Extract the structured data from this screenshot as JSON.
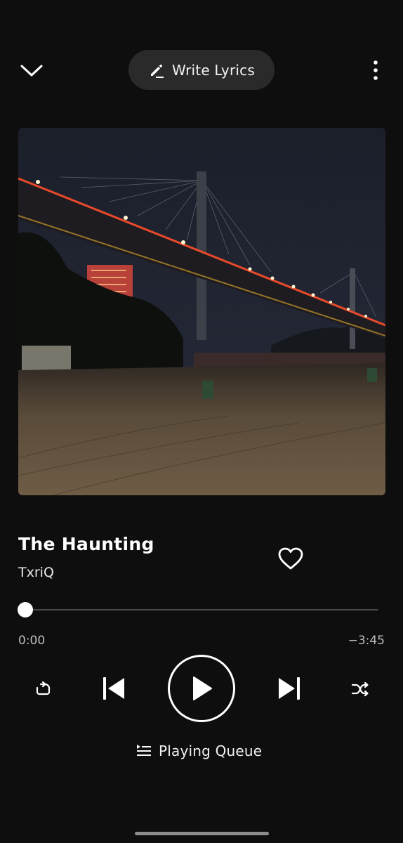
{
  "header": {
    "collapse_icon": "chevron-down-icon",
    "write_lyrics_label": "Write Lyrics",
    "write_lyrics_icon": "pencil-icon",
    "menu_icon": "more-vertical-icon"
  },
  "track": {
    "title": "The Haunting",
    "artist": "TxriQ",
    "liked": false,
    "artwork_description_icon": "album-art-image"
  },
  "playback": {
    "elapsed": "0:00",
    "remaining": "−3:45",
    "progress": 0,
    "state": "paused"
  },
  "controls": {
    "repeat_icon": "repeat-icon",
    "previous_icon": "skip-previous-icon",
    "play_icon": "play-icon",
    "next_icon": "skip-next-icon",
    "shuffle_icon": "shuffle-icon"
  },
  "queue": {
    "label": "Playing Queue",
    "icon": "queue-list-icon"
  },
  "colors": {
    "background": "#0e0e0e",
    "pill": "#2a2a2a",
    "text_primary": "#ffffff",
    "text_secondary": "#bdbdbd",
    "track": "#4a4a4a"
  }
}
